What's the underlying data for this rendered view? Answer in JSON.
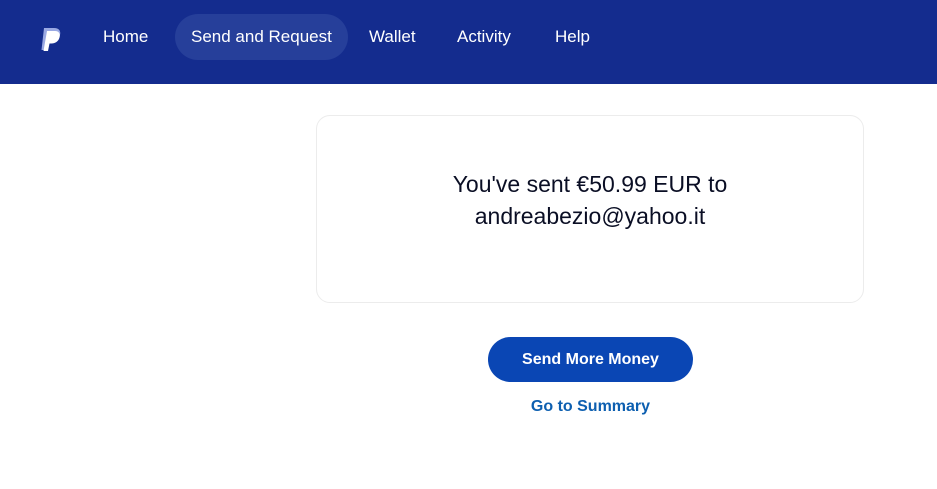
{
  "colors": {
    "header_bg": "#142c8e",
    "active_tab_bg": "#263f9a",
    "primary_button": "#0a46b4",
    "link": "#0d5fb0"
  },
  "header": {
    "logo": "paypal-logo-icon",
    "nav": [
      {
        "label": "Home"
      },
      {
        "label": "Send and Request",
        "active": true
      },
      {
        "label": "Wallet"
      },
      {
        "label": "Activity"
      },
      {
        "label": "Help"
      }
    ]
  },
  "confirmation": {
    "line1": "You've sent €50.99 EUR to",
    "line2": "andreabezio@yahoo.it"
  },
  "actions": {
    "send_more_label": "Send More Money",
    "summary_label": "Go to Summary"
  }
}
